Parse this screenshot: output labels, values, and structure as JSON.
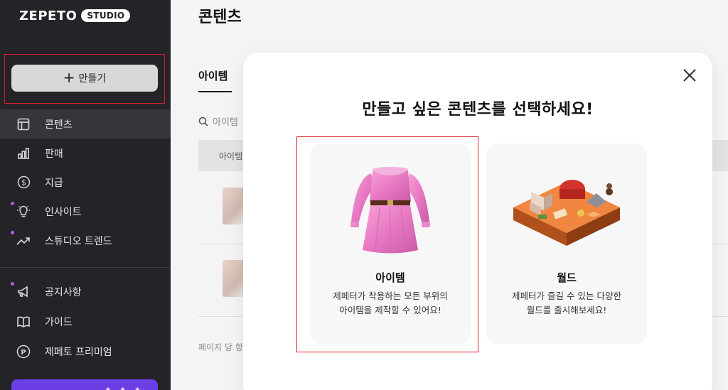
{
  "sidebar": {
    "logo_main": "ZEPETO",
    "logo_badge": "STUDIO",
    "create_label": "만들기",
    "items": [
      {
        "label": "콘텐츠",
        "icon": "layout-icon",
        "active": true,
        "dot": false
      },
      {
        "label": "판매",
        "icon": "bar-chart-icon",
        "active": false,
        "dot": false
      },
      {
        "label": "지급",
        "icon": "dollar-circle-icon",
        "active": false,
        "dot": false
      },
      {
        "label": "인사이트",
        "icon": "lightbulb-icon",
        "active": false,
        "dot": true
      },
      {
        "label": "스튜디오 트렌드",
        "icon": "trend-up-icon",
        "active": false,
        "dot": true
      },
      {
        "label": "공지사항",
        "icon": "megaphone-icon",
        "active": false,
        "dot": true
      },
      {
        "label": "가이드",
        "icon": "book-icon",
        "active": false,
        "dot": false
      },
      {
        "label": "제페토 프리미엄",
        "icon": "premium-p-icon",
        "active": false,
        "dot": false
      }
    ]
  },
  "main": {
    "page_title": "콘텐츠",
    "tab_label": "아이템",
    "search_placeholder": "아이템",
    "table_header_first": "아이템",
    "per_page_label": "페이지 당 항"
  },
  "modal": {
    "title": "만들고 싶은 콘텐츠를 선택하세요!",
    "cards": [
      {
        "title": "아이템",
        "desc_line1": "제페터가 착용하는 모든 부위의",
        "desc_line2": "아이템을 제작할 수 있어요!",
        "illustration": "pink-dress-illustration"
      },
      {
        "title": "월드",
        "desc_line1": "제페터가 즐길 수 있는 다양한",
        "desc_line2": "월드를 출시해보세요!",
        "illustration": "isometric-world-illustration"
      }
    ]
  },
  "colors": {
    "sidebar_bg": "#232328",
    "highlight_red": "#d9202a",
    "accent_purple": "#6b3ee6",
    "notification_dot": "#b05ce6"
  }
}
